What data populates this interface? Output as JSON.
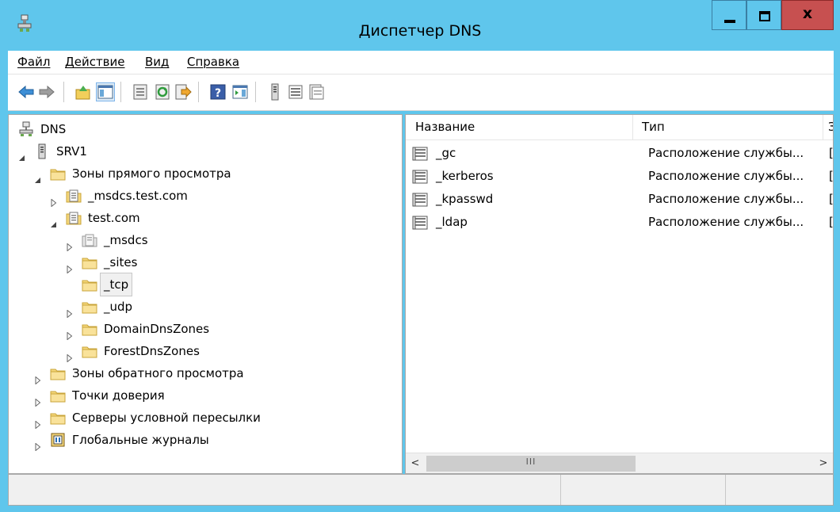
{
  "window": {
    "title": "Диспетчер DNS",
    "close_glyph": "x",
    "accent_color": "#5fc6ec",
    "close_color": "#c75050"
  },
  "menu": [
    "Файл",
    "Действие",
    "Вид",
    "Справка"
  ],
  "toolbar": [
    "back-icon",
    "forward-icon",
    "up-folder-icon",
    "show-hide-tree-icon",
    "properties-icon",
    "refresh-icon",
    "export-list-icon",
    "help-icon",
    "show-action-pane-icon",
    "server-icon",
    "list-icon",
    "details-icon"
  ],
  "tree": [
    {
      "label": "DNS",
      "icon": "dns-server-icon",
      "expander": "none",
      "level": 0
    },
    {
      "label": "SRV1",
      "icon": "server-icon",
      "expander": "expanded",
      "level": 1
    },
    {
      "label": "Зоны прямого просмотра",
      "icon": "folder-icon",
      "expander": "expanded",
      "level": 2
    },
    {
      "label": "_msdcs.test.com",
      "icon": "zone-icon",
      "expander": "collapsed",
      "level": 3
    },
    {
      "label": "test.com",
      "icon": "zone-icon",
      "expander": "expanded",
      "level": 3
    },
    {
      "label": "_msdcs",
      "icon": "delegated-zone-icon",
      "expander": "collapsed",
      "level": 4
    },
    {
      "label": "_sites",
      "icon": "folder-icon",
      "expander": "collapsed",
      "level": 4
    },
    {
      "label": "_tcp",
      "icon": "folder-icon",
      "expander": "none",
      "level": 4,
      "selected": true
    },
    {
      "label": "_udp",
      "icon": "folder-icon",
      "expander": "collapsed",
      "level": 4
    },
    {
      "label": "DomainDnsZones",
      "icon": "folder-icon",
      "expander": "collapsed",
      "level": 4
    },
    {
      "label": "ForestDnsZones",
      "icon": "folder-icon",
      "expander": "collapsed",
      "level": 4
    },
    {
      "label": "Зоны обратного просмотра",
      "icon": "folder-icon",
      "expander": "collapsed",
      "level": 2
    },
    {
      "label": "Точки доверия",
      "icon": "folder-icon",
      "expander": "collapsed",
      "level": 2
    },
    {
      "label": "Серверы условной пересылки",
      "icon": "folder-icon",
      "expander": "collapsed",
      "level": 2
    },
    {
      "label": "Глобальные журналы",
      "icon": "event-log-icon",
      "expander": "collapsed",
      "level": 2
    }
  ],
  "list": {
    "columns": [
      "Название",
      "Тип",
      "З"
    ],
    "rows": [
      {
        "name": "_gc",
        "type": "Расположение службы...",
        "data": "["
      },
      {
        "name": "_kerberos",
        "type": "Расположение службы...",
        "data": "["
      },
      {
        "name": "_kpasswd",
        "type": "Расположение службы...",
        "data": "["
      },
      {
        "name": "_ldap",
        "type": "Расположение службы...",
        "data": "["
      }
    ],
    "scroll_left": "<",
    "scroll_right": ">",
    "scroll_grip": "III"
  }
}
